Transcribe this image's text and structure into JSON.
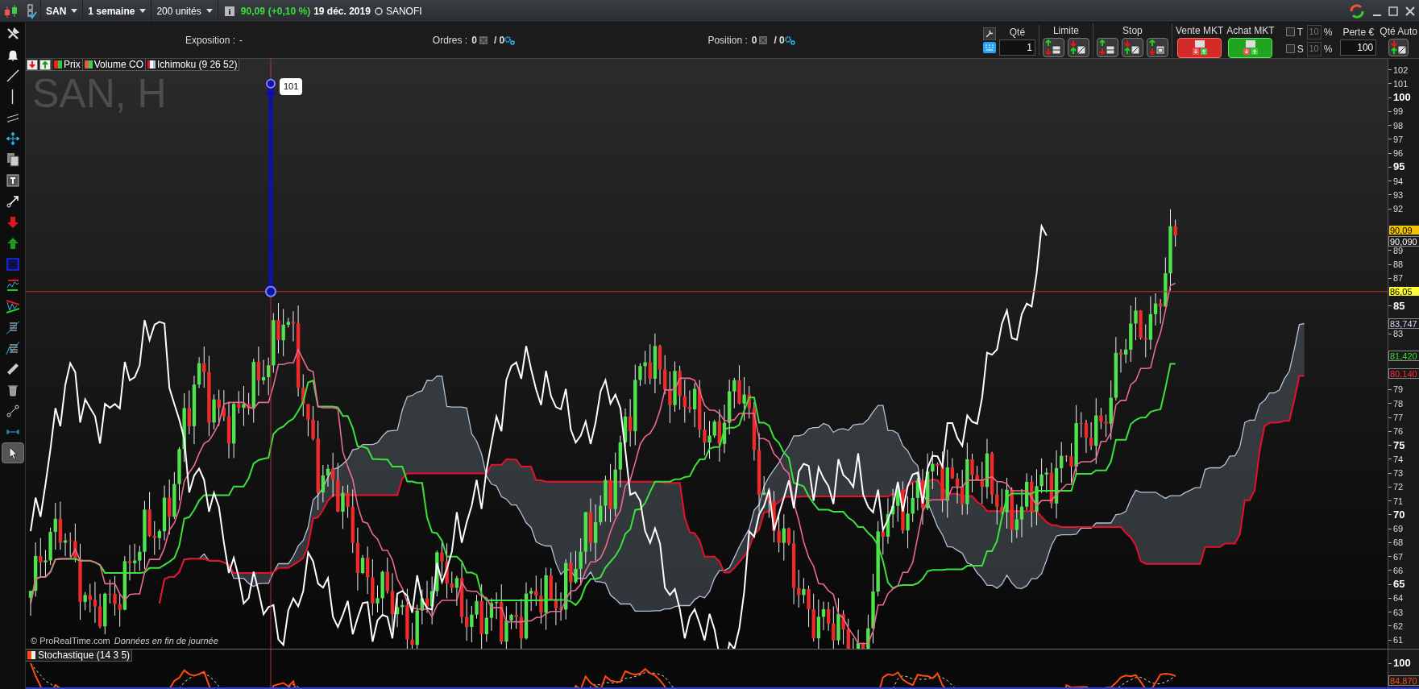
{
  "top_bar": {
    "symbol": "SAN",
    "period": "1 semaine",
    "units": "200 unités",
    "price": "90,09",
    "change": "(+0,10 %)",
    "date": "19 déc. 2019",
    "name": "SANOFI"
  },
  "tools": [
    {
      "kind": "tools",
      "selected": false
    },
    {
      "kind": "alert",
      "selected": false
    },
    {
      "kind": "line",
      "selected": false
    },
    {
      "kind": "vline",
      "selected": false
    },
    {
      "kind": "channel",
      "selected": false
    },
    {
      "kind": "move",
      "selected": false
    },
    {
      "kind": "copy",
      "selected": false
    },
    {
      "kind": "text",
      "selected": false
    },
    {
      "kind": "arrow",
      "selected": false
    },
    {
      "kind": "down",
      "selected": false
    },
    {
      "kind": "up",
      "selected": false
    },
    {
      "kind": "rect",
      "selected": false
    },
    {
      "kind": "trend",
      "selected": false
    },
    {
      "kind": "triangle",
      "selected": false
    },
    {
      "kind": "fib",
      "selected": false
    },
    {
      "kind": "fib2",
      "selected": false
    },
    {
      "kind": "ruler",
      "selected": false
    },
    {
      "kind": "trash",
      "selected": false
    },
    {
      "kind": "segment",
      "selected": false
    },
    {
      "kind": "measure",
      "selected": false
    },
    {
      "kind": "cursor",
      "selected": true
    }
  ],
  "info_bar": [
    {
      "kind": "text",
      "label": "Exposition :",
      "value": "-"
    },
    {
      "kind": "orders",
      "label": "Ordres :",
      "value": "0",
      "total": "/ 0"
    },
    {
      "kind": "orders",
      "label": "Position :",
      "value": "0",
      "total": "/ 0"
    }
  ],
  "order_panel": {
    "qty": {
      "label": "Qté",
      "value": "1"
    },
    "groups": [
      {
        "label": "Limite",
        "buttons": [
          {
            "kind": "buy"
          },
          {
            "kind": "sell"
          }
        ]
      },
      {
        "label": "Stop",
        "buttons": [
          {
            "kind": "buy"
          },
          {
            "kind": "sell"
          },
          {
            "kind": "oco"
          }
        ]
      }
    ],
    "market": [
      {
        "label": "Vente MKT",
        "kind": "sell"
      },
      {
        "label": "Achat MKT",
        "kind": "buy"
      }
    ],
    "risk": [
      {
        "letter": "T",
        "checked": false,
        "value": "10",
        "disabled": true,
        "unit": "%"
      },
      {
        "letter": "S",
        "checked": false,
        "value": "10",
        "disabled": true,
        "unit": "%"
      }
    ],
    "loss": {
      "label": "Perte €",
      "value": "100"
    },
    "auto": {
      "label": "Qté Auto"
    }
  },
  "chart": {
    "title": "SAN, H",
    "legend": [
      {
        "kind": "candles",
        "label": "Prix"
      },
      {
        "kind": "volume",
        "label": "Volume CO"
      },
      {
        "kind": "ichimoku",
        "label": "Ichimoku (9 26 52)"
      }
    ],
    "arrow_label": "101",
    "brand": "© ProRealTime.com",
    "note": "Données en fin de journée",
    "yticks": [
      {
        "label": "102",
        "major": false
      },
      {
        "label": "101",
        "major": false
      },
      {
        "label": "100",
        "major": true
      },
      {
        "label": "99",
        "major": false
      },
      {
        "label": "98",
        "major": false
      },
      {
        "label": "97",
        "major": false
      },
      {
        "label": "96",
        "major": false
      },
      {
        "label": "95",
        "major": true
      },
      {
        "label": "94",
        "major": false
      },
      {
        "label": "93",
        "major": false
      },
      {
        "label": "92",
        "major": false
      },
      {
        "label": "89",
        "major": false
      },
      {
        "label": "88",
        "major": false
      },
      {
        "label": "87",
        "major": false
      },
      {
        "label": "85",
        "major": true
      },
      {
        "label": "83",
        "major": false
      },
      {
        "label": "79",
        "major": false
      },
      {
        "label": "78",
        "major": false
      },
      {
        "label": "77",
        "major": false
      },
      {
        "label": "76",
        "major": false
      },
      {
        "label": "75",
        "major": true
      },
      {
        "label": "74",
        "major": false
      },
      {
        "label": "73",
        "major": false
      },
      {
        "label": "72",
        "major": false
      },
      {
        "label": "71",
        "major": false
      },
      {
        "label": "70",
        "major": true
      },
      {
        "label": "69",
        "major": false
      },
      {
        "label": "68",
        "major": false
      },
      {
        "label": "67",
        "major": false
      },
      {
        "label": "66",
        "major": false
      },
      {
        "label": "65",
        "major": true
      },
      {
        "label": "64",
        "major": false
      },
      {
        "label": "63",
        "major": false
      },
      {
        "label": "62",
        "major": false
      },
      {
        "label": "61",
        "major": false
      }
    ],
    "price_tags": [
      {
        "label": "90,09",
        "kind": "filled",
        "color": "#f5c400"
      },
      {
        "label": "90,090",
        "kind": "outline",
        "color": "#ffffff"
      },
      {
        "label": "86,05",
        "kind": "filled",
        "color": "#ffff33"
      },
      {
        "label": "83,747",
        "kind": "outline",
        "color": "#d6dcff"
      },
      {
        "label": "81,420",
        "kind": "outline",
        "color": "#33dd33"
      },
      {
        "label": "80,140",
        "kind": "outline",
        "color": "#ff2a3a"
      }
    ]
  },
  "stochastic": {
    "title": "Stochastique (14 3 5)",
    "yticks": [
      {
        "label": "100",
        "major": true
      }
    ],
    "price_tags": [
      {
        "label": "84,870",
        "kind": "outline",
        "color": "#ff4a1a"
      }
    ]
  }
}
